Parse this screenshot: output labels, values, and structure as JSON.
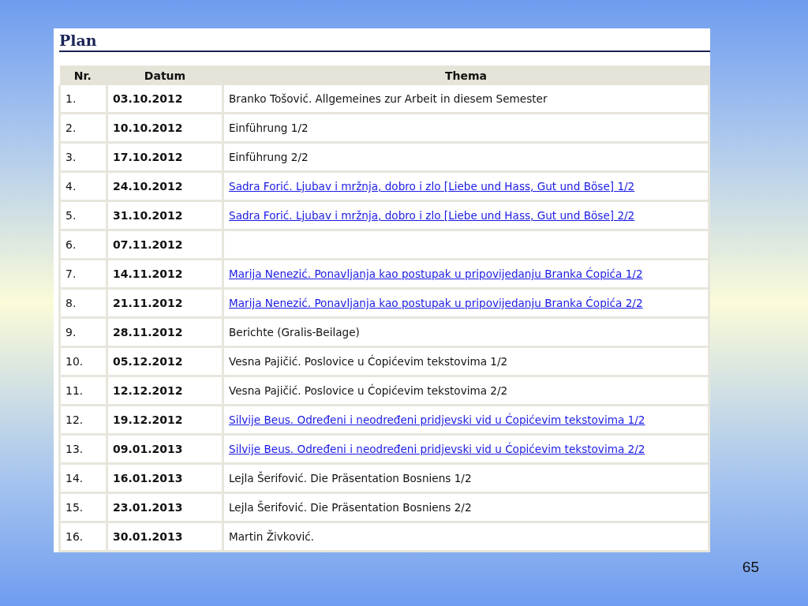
{
  "title": "Plan",
  "columns": [
    "Nr.",
    "Datum",
    "Thema"
  ],
  "rows": [
    {
      "nr": "1.",
      "date": "03.10.2012",
      "topic": {
        "kind": "text",
        "text": "Branko Tošović. Allgemeines zur Arbeit in diesem Semester"
      }
    },
    {
      "nr": "2.",
      "date": "10.10.2012",
      "topic": {
        "kind": "text",
        "text": "Einführung 1/2"
      }
    },
    {
      "nr": "3.",
      "date": "17.10.2012",
      "topic": {
        "kind": "text",
        "text": "Einführung 2/2"
      }
    },
    {
      "nr": "4.",
      "date": "24.10.2012",
      "topic": {
        "kind": "link",
        "text": "Sadra Forić. Ljubav i mržnja, dobro i zlo [Liebe und Hass, Gut und Böse] 1/2"
      }
    },
    {
      "nr": "5.",
      "date": "31.10.2012",
      "topic": {
        "kind": "link",
        "text": "Sadra Forić. Ljubav i mržnja, dobro i zlo [Liebe und Hass, Gut und Böse] 2/2"
      }
    },
    {
      "nr": "6.",
      "date": "07.11.2012"
    },
    {
      "nr": "7.",
      "date": "14.11.2012",
      "topic": {
        "kind": "link",
        "text": "Marija Nenezić. Ponavljanja kao postupak u pripovijedanju Branka Ćopića 1/2"
      }
    },
    {
      "nr": "8.",
      "date": "21.11.2012",
      "topic": {
        "kind": "link",
        "text": "Marija Nenezić. Ponavljanja kao postupak u pripovijedanju Branka Ćopića 2/2"
      }
    },
    {
      "nr": "9.",
      "date": "28.11.2012",
      "topic": {
        "kind": "text",
        "text": "Berichte (Gralis-Beilage)"
      }
    },
    {
      "nr": "10.",
      "date": "05.12.2012",
      "topic": {
        "kind": "text",
        "text": "Vesna Pajičić. Poslovice u Ćopićevim tekstovima 1/2"
      }
    },
    {
      "nr": "11.",
      "date": "12.12.2012",
      "topic": {
        "kind": "text",
        "text": "Vesna Pajičić. Poslovice u Ćopićevim tekstovima 2/2"
      }
    },
    {
      "nr": "12.",
      "date": "19.12.2012",
      "topic": {
        "kind": "link",
        "text": "Silvije Beus. Određeni i neodređeni pridjevski vid u Ćopićevim tekstovima 1/2"
      }
    },
    {
      "nr": "13.",
      "date": "09.01.2013",
      "topic": {
        "kind": "link",
        "text": "Silvije Beus. Određeni i neodređeni pridjevski vid u Ćopićevim tekstovima 2/2"
      }
    },
    {
      "nr": "14.",
      "date": "16.01.2013",
      "topic": {
        "kind": "text",
        "text": "Lejla Šerifović. Die Präsentation Bosniens 1/2"
      }
    },
    {
      "nr": "15.",
      "date": "23.01.2013",
      "topic": {
        "kind": "text",
        "text": "Lejla Šerifović. Die Präsentation Bosniens 2/2"
      }
    },
    {
      "nr": "16.",
      "date": "30.01.2013",
      "topic": {
        "kind": "text",
        "text": "Martin Živković."
      }
    }
  ],
  "page_number": "65"
}
